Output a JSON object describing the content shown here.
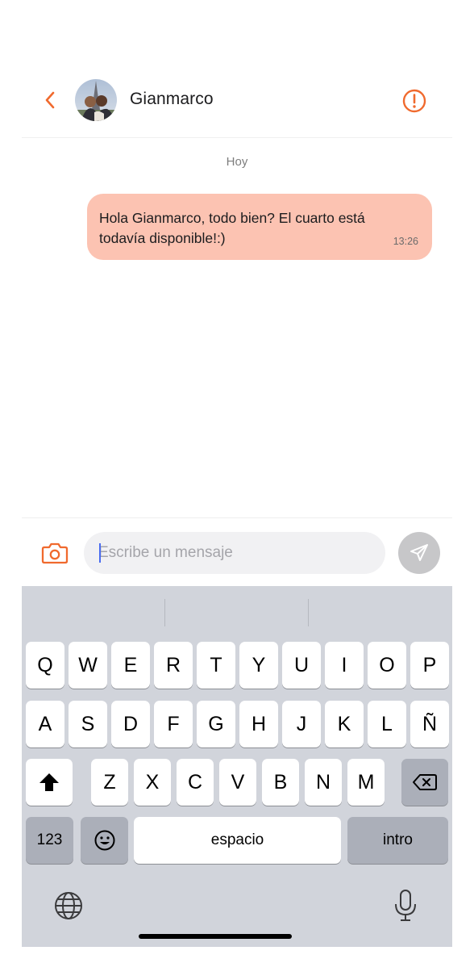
{
  "header": {
    "back_icon": "chevron-left-icon",
    "contact_name": "Gianmarco",
    "report_icon": "exclamation-circle-icon",
    "accent_color": "#f06a2e"
  },
  "conversation": {
    "day_label": "Hoy",
    "messages": [
      {
        "text": "Hola Gianmarco, todo bien? El cuarto está todavía disponible!:)",
        "time": "13:26",
        "bubble_color": "#fcc3b2"
      }
    ]
  },
  "composer": {
    "camera_icon": "camera-icon",
    "input_value": "",
    "input_placeholder": "Escribe un mensaje",
    "send_icon": "send-icon"
  },
  "keyboard": {
    "row1": [
      "Q",
      "W",
      "E",
      "R",
      "T",
      "Y",
      "U",
      "I",
      "O",
      "P"
    ],
    "row2": [
      "A",
      "S",
      "D",
      "F",
      "G",
      "H",
      "J",
      "K",
      "L",
      "Ñ"
    ],
    "row3": [
      "Z",
      "X",
      "C",
      "V",
      "B",
      "N",
      "M"
    ],
    "numbers_label": "123",
    "space_label": "espacio",
    "return_label": "intro",
    "shift_icon": "shift-icon",
    "delete_icon": "delete-icon",
    "emoji_icon": "emoji-icon",
    "globe_icon": "globe-icon",
    "mic_icon": "microphone-icon"
  }
}
